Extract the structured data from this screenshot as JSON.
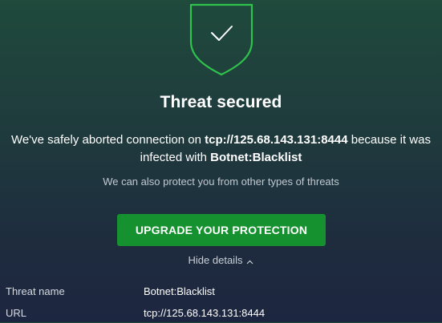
{
  "icons": {
    "shield": "shield-check-icon",
    "chevron": "chevron-up-icon"
  },
  "colors": {
    "accent": "#16912f",
    "shield": "#2fc24c"
  },
  "title": "Threat secured",
  "message": {
    "part1": "We've safely aborted connection on ",
    "url": "tcp://125.68.143.131:8444",
    "part2": " because it was infected with ",
    "threat": "Botnet:Blacklist"
  },
  "subtext": "We can also protect you from other types of threats",
  "upgrade_button": "UPGRADE YOUR PROTECTION",
  "hide_details": "Hide details",
  "details": [
    {
      "label": "Threat name",
      "value": "Botnet:Blacklist"
    },
    {
      "label": "URL",
      "value": "tcp://125.68.143.131:8444"
    }
  ]
}
